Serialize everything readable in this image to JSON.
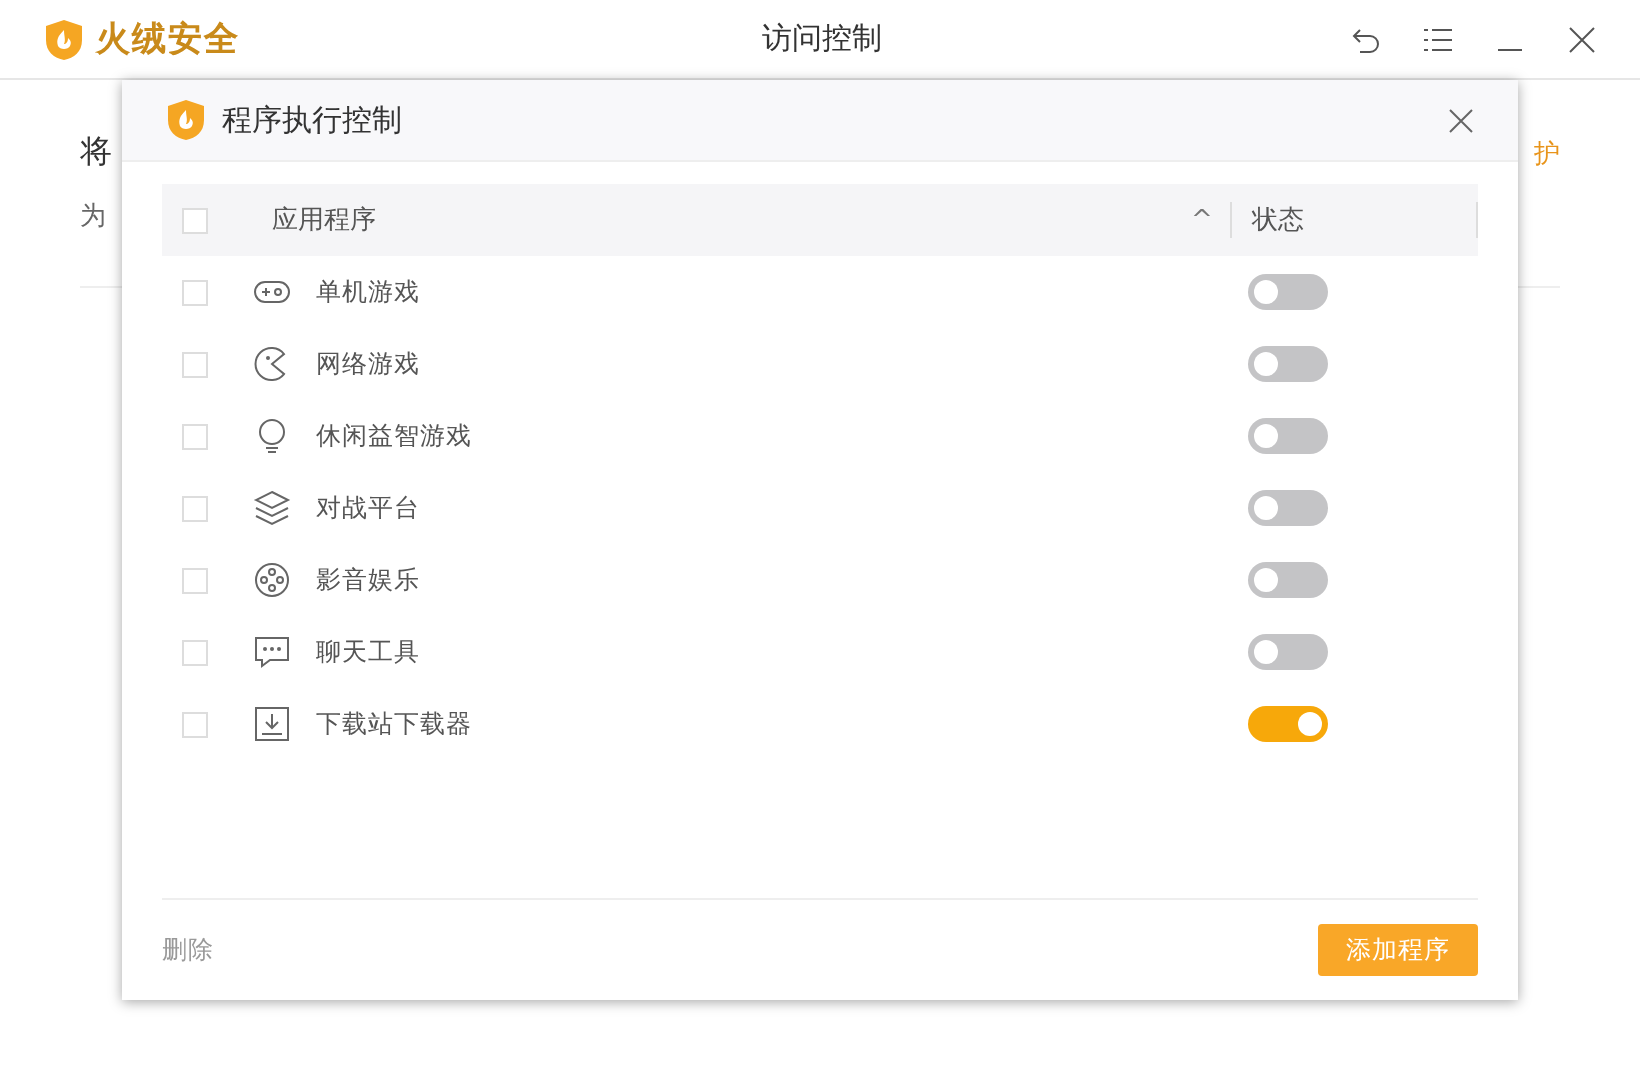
{
  "window": {
    "app_name": "火绒安全",
    "title": "访问控制"
  },
  "background": {
    "heading": "将",
    "description": "为",
    "link": "护"
  },
  "dialog": {
    "title": "程序执行控制",
    "columns": {
      "name": "应用程序",
      "sort_icon": "^",
      "status": "状态"
    },
    "header_checked": false,
    "rows": [
      {
        "name": "单机游戏",
        "checked": false,
        "on": false
      },
      {
        "name": "网络游戏",
        "checked": false,
        "on": false
      },
      {
        "name": "休闲益智游戏",
        "checked": false,
        "on": false
      },
      {
        "name": "对战平台",
        "checked": false,
        "on": false
      },
      {
        "name": "影音娱乐",
        "checked": false,
        "on": false
      },
      {
        "name": "聊天工具",
        "checked": false,
        "on": false
      },
      {
        "name": "下载站下载器",
        "checked": false,
        "on": true
      }
    ],
    "delete_label": "删除",
    "add_label": "添加程序"
  }
}
